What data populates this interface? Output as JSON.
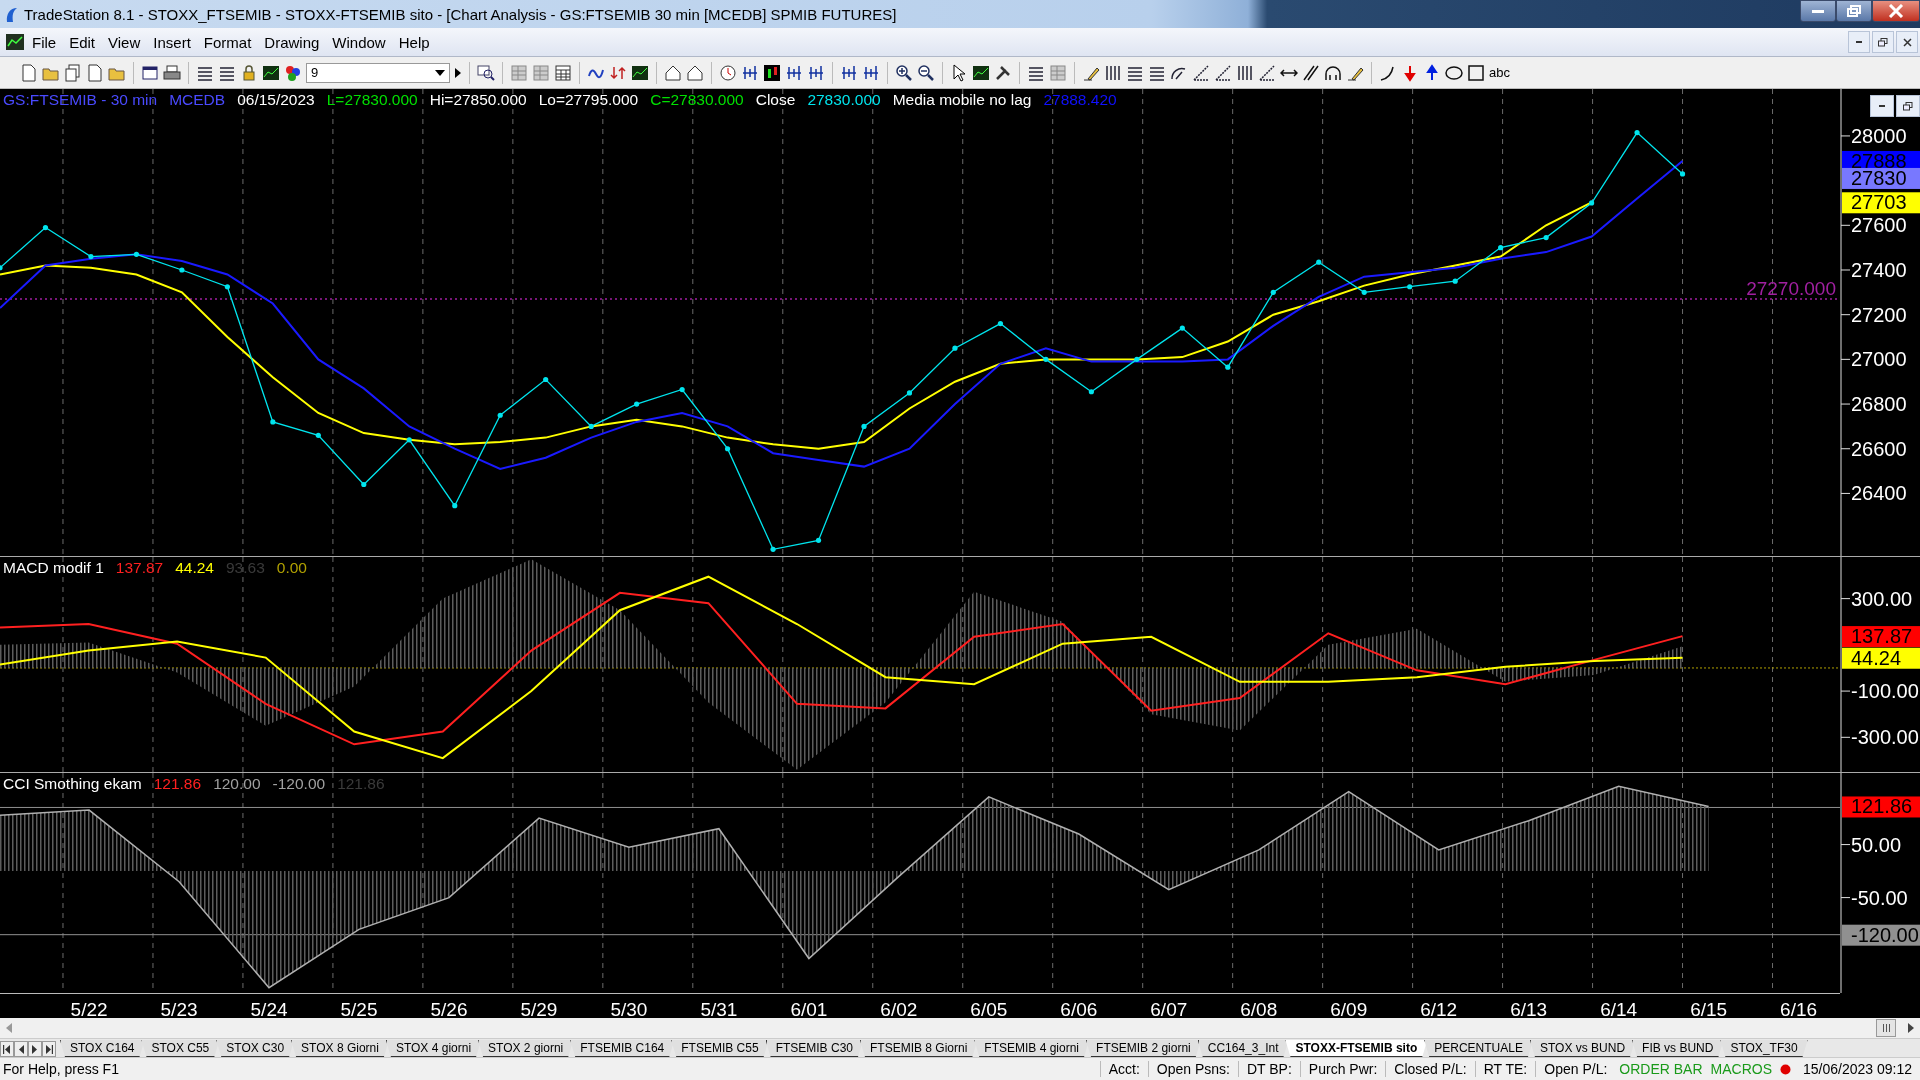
{
  "window": {
    "title": "TradeStation 8.1 - STOXX_FTSEMIB - STOXX-FTSEMIB sito - [Chart Analysis - GS:FTSEMIB  30 min  [MCEDB] SPMIB FUTURES]"
  },
  "menu": [
    "File",
    "Edit",
    "View",
    "Insert",
    "Format",
    "Drawing",
    "Window",
    "Help"
  ],
  "toolbar": {
    "symbol_field": {
      "value": "9"
    },
    "text_tool": "abc"
  },
  "panels": [
    {
      "legend": [
        {
          "text": "GS:FTSEMIB - 30 min",
          "color": "#4a4aff"
        },
        {
          "text": "MCEDB",
          "color": "#4a4aff"
        },
        {
          "text": "06/15/2023",
          "color": "#ffffff"
        },
        {
          "text": "L=27830.000",
          "color": "#00e000"
        },
        {
          "text": "Hi=27850.000",
          "color": "#ffffff"
        },
        {
          "text": "Lo=27795.000",
          "color": "#ffffff"
        },
        {
          "text": "C=27830.000",
          "color": "#00e000"
        },
        {
          "text": "Close",
          "color": "#ffffff"
        },
        {
          "text": "27830.000",
          "color": "#00e5ee"
        },
        {
          "text": "Media mobile no lag",
          "color": "#ffffff"
        },
        {
          "text": "27888.420",
          "color": "#1010ff"
        }
      ],
      "value_markers": [
        {
          "label": "27888",
          "color": "#0000ff"
        },
        {
          "label": "27830",
          "color": "#7878ff"
        },
        {
          "label": "27703",
          "color": "#ffff00"
        }
      ],
      "chart_data": {
        "type": "line",
        "ylim": [
          26120,
          28210
        ],
        "yticks": [
          {
            "value": 28000,
            "label": "28000"
          },
          {
            "value": 27600,
            "label": "27600"
          },
          {
            "value": 27400,
            "label": "27400"
          },
          {
            "value": 27200,
            "label": "27200"
          },
          {
            "value": 27000,
            "label": "27000"
          },
          {
            "value": 26800,
            "label": "26800"
          },
          {
            "value": 26600,
            "label": "26600"
          },
          {
            "value": 26400,
            "label": "26400"
          }
        ],
        "categories": [
          null,
          null,
          null,
          null,
          null,
          null,
          null,
          null,
          null,
          null,
          null,
          null,
          null,
          null,
          null,
          null,
          null,
          null,
          null,
          null,
          null,
          null,
          null,
          null,
          null,
          null,
          null,
          null,
          null,
          null,
          null,
          null,
          null,
          null,
          null,
          null,
          null,
          null
        ],
        "grid": true,
        "ref_lines": [
          {
            "axis": "y",
            "value": 27270,
            "label": "27270.000",
            "color": "#a020a0"
          }
        ],
        "series": [
          {
            "color": "#ffff00",
            "values": [
              27380,
              27420,
              27410,
              27380,
              27300,
              27100,
              26920,
              26760,
              26670,
              26640,
              26620,
              26630,
              26650,
              26700,
              26730,
              26700,
              26650,
              26620,
              26600,
              26630,
              26780,
              26900,
              26980,
              27000,
              27000,
              27000,
              27010,
              27080,
              27200,
              27260,
              27330,
              27380,
              27420,
              27460,
              27600,
              27703,
              null,
              null
            ]
          },
          {
            "color": "#1a1aff",
            "values": [
              27230,
              27420,
              27450,
              27470,
              27440,
              27380,
              27250,
              27000,
              26870,
              26700,
              26600,
              26510,
              26560,
              26650,
              26720,
              26760,
              26700,
              26580,
              26550,
              26520,
              26600,
              26800,
              26980,
              27050,
              26990,
              26990,
              26990,
              27000,
              27150,
              27280,
              27370,
              27390,
              27410,
              27450,
              27480,
              27550,
              27720,
              27888
            ]
          },
          {
            "color": "#00e5ee",
            "values": [
              27410,
              27590,
              27460,
              27470,
              27400,
              27325,
              26720,
              26660,
              26440,
              26640,
              26345,
              26750,
              26910,
              26700,
              26800,
              26865,
              26600,
              26150,
              26190,
              26700,
              26850,
              27050,
              27160,
              27000,
              26855,
              27000,
              27140,
              26965,
              27300,
              27435,
              27300,
              27325,
              27350,
              27500,
              27545,
              27700,
              28015,
              27830
            ]
          }
        ]
      }
    },
    {
      "legend": [
        {
          "text": "MACD modif 1",
          "color": "#ffffff"
        },
        {
          "text": "137.87",
          "color": "#ff2020"
        },
        {
          "text": "44.24",
          "color": "#ffff00"
        },
        {
          "text": "93.63",
          "color": "#3a3a3a"
        },
        {
          "text": "0.00",
          "color": "#b0a000"
        }
      ],
      "value_markers": [
        {
          "label": "137.87",
          "color": "#ff0000"
        },
        {
          "label": "44.24",
          "color": "#ffff00"
        }
      ],
      "chart_data": {
        "type": "line",
        "ylim": [
          -450,
          480
        ],
        "yticks": [
          {
            "value": 300,
            "label": "300.00"
          },
          {
            "value": -100,
            "label": "-100.00"
          },
          {
            "value": -300,
            "label": "-300.00"
          }
        ],
        "categories": [
          null,
          null,
          null,
          null,
          null,
          null,
          null,
          null,
          null,
          null,
          null,
          null,
          null,
          null,
          null,
          null,
          null,
          null,
          null,
          null
        ],
        "grid": true,
        "ref_lines": [
          {
            "axis": "y",
            "value": 0,
            "color": "#b0a000"
          }
        ],
        "series": [
          {
            "type": "area",
            "color": "#5c5c5c",
            "values": [
              100,
              110,
              -20,
              -250,
              -80,
              300,
              470,
              250,
              -150,
              -440,
              -150,
              330,
              200,
              -200,
              -270,
              100,
              170,
              -60,
              -30,
              94
            ]
          },
          {
            "color": "#ff2020",
            "values": [
              175,
              190,
              105,
              -155,
              -330,
              -275,
              75,
              325,
              280,
              -155,
              -175,
              135,
              190,
              -185,
              -130,
              150,
              -10,
              -70,
              35,
              138
            ]
          },
          {
            "color": "#ffff00",
            "values": [
              15,
              75,
              115,
              45,
              -275,
              -390,
              -100,
              250,
              395,
              190,
              -40,
              -70,
              105,
              135,
              -60,
              -60,
              -40,
              5,
              30,
              44
            ]
          }
        ]
      }
    },
    {
      "legend": [
        {
          "text": "CCI Smothing ekam",
          "color": "#ffffff"
        },
        {
          "text": "121.86",
          "color": "#ff2020"
        },
        {
          "text": "120.00",
          "color": "#a0a0a0"
        },
        {
          "text": "-120.00",
          "color": "#a0a0a0"
        },
        {
          "text": "121.86",
          "color": "#3a3a3a"
        }
      ],
      "value_markers": [
        {
          "label": "121.86",
          "color": "#ff0000"
        },
        {
          "label": "-120.00",
          "color": "#909090"
        }
      ],
      "chart_data": {
        "type": "area",
        "ylim": [
          -230,
          185
        ],
        "yticks": [
          {
            "value": 50,
            "label": "50.00"
          },
          {
            "value": -50,
            "label": "-50.00"
          }
        ],
        "categories": [
          null,
          "5/22",
          "5/23",
          "5/24",
          "5/25",
          "5/26",
          "5/29",
          "5/30",
          "5/31",
          "6/01",
          "6/02",
          "6/05",
          "6/06",
          "6/07",
          "6/08",
          "6/09",
          "6/12",
          "6/13",
          "6/14",
          "6/15",
          "6/16"
        ],
        "grid": true,
        "ref_lines": [
          {
            "axis": "y",
            "value": 120,
            "color": "#909090"
          },
          {
            "axis": "y",
            "value": -120,
            "color": "#909090"
          }
        ],
        "series": [
          {
            "color": "#b0b0b0",
            "values": [
              105,
              115,
              -20,
              -220,
              -110,
              -50,
              100,
              45,
              80,
              -165,
              -10,
              140,
              70,
              -35,
              40,
              150,
              40,
              95,
              160,
              122,
              null
            ]
          }
        ]
      }
    }
  ],
  "tabs": [
    {
      "label": "STOX C164",
      "selected": false
    },
    {
      "label": "STOX C55",
      "selected": false
    },
    {
      "label": "STOX  C30",
      "selected": false
    },
    {
      "label": "STOX  8 Giorni",
      "selected": false
    },
    {
      "label": "STOX 4 giorni",
      "selected": false
    },
    {
      "label": "STOX  2 giorni",
      "selected": false
    },
    {
      "label": "FTSEMIB C164",
      "selected": false
    },
    {
      "label": "FTSEMIB C55",
      "selected": false
    },
    {
      "label": "FTSEMIB C30",
      "selected": false
    },
    {
      "label": "FTSEMIB  8 Giorni",
      "selected": false
    },
    {
      "label": "FTSEMIB  4 giorni",
      "selected": false
    },
    {
      "label": "FTSEMIB  2 giorni",
      "selected": false
    },
    {
      "label": "CC164_3_Int",
      "selected": false
    },
    {
      "label": "STOXX-FTSEMIB sito",
      "selected": true
    },
    {
      "label": "PERCENTUALE",
      "selected": false
    },
    {
      "label": "STOX vs BUND",
      "selected": false
    },
    {
      "label": "FIB vs BUND",
      "selected": false
    },
    {
      "label": "STOX_TF30",
      "selected": false
    }
  ],
  "status_bar": {
    "help": "For Help, press F1",
    "fields": [
      "Acct:",
      "Open Psns:",
      "DT BP:",
      "Purch Pwr:",
      "Closed P/L:",
      "RT TE:",
      "Open P/L:"
    ],
    "order_bar": "ORDER BAR",
    "macros": "MACROS",
    "macros_on": true,
    "datetime": "15/06/2023 09:12"
  }
}
